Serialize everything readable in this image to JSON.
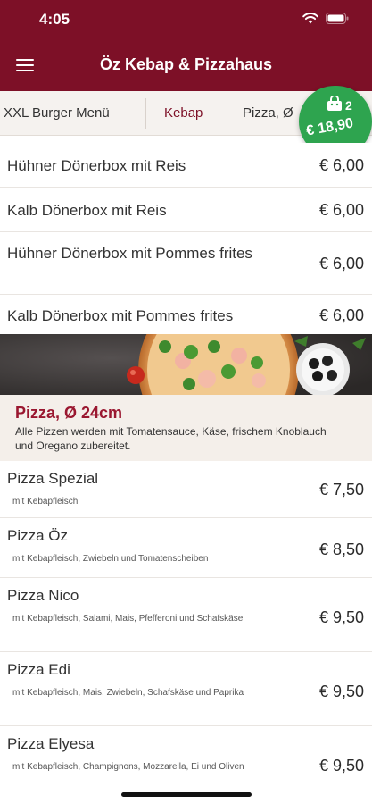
{
  "status": {
    "time": "4:05"
  },
  "header": {
    "title": "Öz Kebap & Pizzahaus",
    "menu_icon": "hamburger-menu-icon",
    "brand_color": "#7d1027"
  },
  "tabs": [
    {
      "label": "XXL Burger  Menü",
      "active": false
    },
    {
      "label": "Kebap",
      "active": true
    },
    {
      "label": "Pizza, Ø",
      "active": false
    }
  ],
  "cart": {
    "count": "2",
    "total": "€ 18,90",
    "icon": "shopping-bag-icon",
    "color": "#2ea44f"
  },
  "kebap_items": [
    {
      "name": "Hühner Dönerbox mit Reis",
      "price": "€ 6,00"
    },
    {
      "name": "Kalb Dönerbox mit Reis",
      "price": "€ 6,00"
    },
    {
      "name": "Hühner Dönerbox mit Pommes frites",
      "price": "€ 6,00"
    },
    {
      "name": "Kalb Dönerbox mit Pommes frites",
      "price": "€ 6,00"
    }
  ],
  "pizza_section": {
    "title": "Pizza, Ø 24cm",
    "description": "Alle Pizzen werden mit Tomatensauce, Käse, frischem Knoblauch und Oregano zubereitet."
  },
  "pizza_items": [
    {
      "name": "Pizza Spezial",
      "desc": "mit Kebapfleisch",
      "price": "€ 7,50"
    },
    {
      "name": "Pizza Öz",
      "desc": "mit Kebapfleisch, Zwiebeln und Tomatenscheiben",
      "price": "€ 8,50"
    },
    {
      "name": "Pizza Nico",
      "desc": "mit Kebapfleisch, Salami, Mais, Pfefferoni und Schafskäse",
      "price": "€ 9,50"
    },
    {
      "name": "Pizza Edi",
      "desc": "mit Kebapfleisch, Mais, Zwiebeln, Schafskäse und Paprika",
      "price": "€ 9,50"
    },
    {
      "name": "Pizza Elyesa",
      "desc": "mit Kebapfleisch, Champignons, Mozzarella, Ei und Oliven",
      "price": "€ 9,50"
    }
  ]
}
